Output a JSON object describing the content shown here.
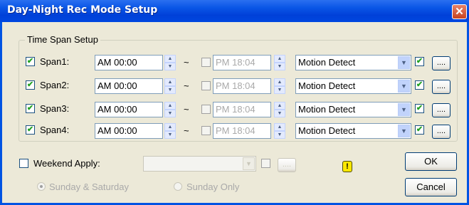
{
  "window": {
    "title": "Day-Night Rec Mode Setup",
    "close_glyph": "✕"
  },
  "group": {
    "label": "Time Span Setup"
  },
  "spans": [
    {
      "checked": "✔",
      "label": "Span1:",
      "start": "AM 00:00",
      "separator": "~",
      "end": "PM 18:04",
      "mode": "Motion Detect",
      "mode_checked": "✔",
      "more": "...."
    },
    {
      "checked": "✔",
      "label": "Span2:",
      "start": "AM 00:00",
      "separator": "~",
      "end": "PM 18:04",
      "mode": "Motion Detect",
      "mode_checked": "✔",
      "more": "...."
    },
    {
      "checked": "✔",
      "label": "Span3:",
      "start": "AM 00:00",
      "separator": "~",
      "end": "PM 18:04",
      "mode": "Motion Detect",
      "mode_checked": "✔",
      "more": "...."
    },
    {
      "checked": "✔",
      "label": "Span4:",
      "start": "AM 00:00",
      "separator": "~",
      "end": "PM 18:04",
      "mode": "Motion Detect",
      "mode_checked": "✔",
      "more": "...."
    }
  ],
  "weekend": {
    "label": "Weekend Apply:",
    "mode": "",
    "more": "....",
    "warning_glyph": "!"
  },
  "radios": {
    "option1": "Sunday & Saturday",
    "option2": "Sunday Only"
  },
  "buttons": {
    "ok": "OK",
    "cancel": "Cancel"
  },
  "glyphs": {
    "spin_up": "▲",
    "spin_down": "▼",
    "dropdown": "▼"
  }
}
